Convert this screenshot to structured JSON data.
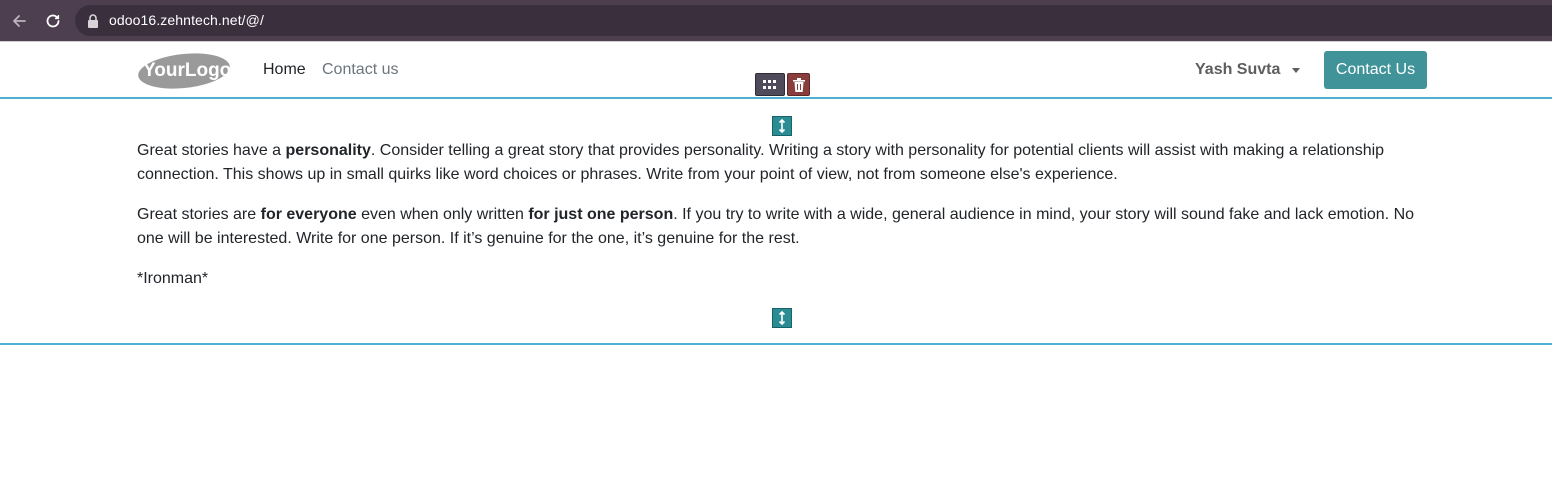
{
  "browser": {
    "url": "odoo16.zehntech.net/@/"
  },
  "header": {
    "logo_text": "YourLogo",
    "nav": [
      {
        "label": "Home"
      },
      {
        "label": "Contact us"
      }
    ],
    "user_name": "Yash Suvta",
    "cta_label": "Contact Us"
  },
  "content": {
    "p1": {
      "a": "Great stories have a ",
      "b": "personality",
      "c": ". Consider telling a great story that provides personality. Writing a story with personality for potential clients will assist with making a relationship connection. This shows up in small quirks like word choices or phrases. Write from your point of view, not from someone else's experience."
    },
    "p2": {
      "a": "Great stories are ",
      "b": "for everyone",
      "c": " even when only written ",
      "d": "for just one person",
      "e": ". If you try to write with a wide, general audience in mind, your story will sound fake and lack emotion. No one will be interested. Write for one person. If it’s genuine for the one, it’s genuine for the rest."
    },
    "p3": "*Ironman*"
  },
  "colors": {
    "accent": "#3f9399",
    "selection_line": "#4bb3d1",
    "chrome_bg": "#4d3f4f"
  },
  "icons": [
    "back-arrow-icon",
    "reload-icon",
    "lock-icon",
    "grid-icon",
    "trash-icon",
    "vertical-resize-icon"
  ]
}
